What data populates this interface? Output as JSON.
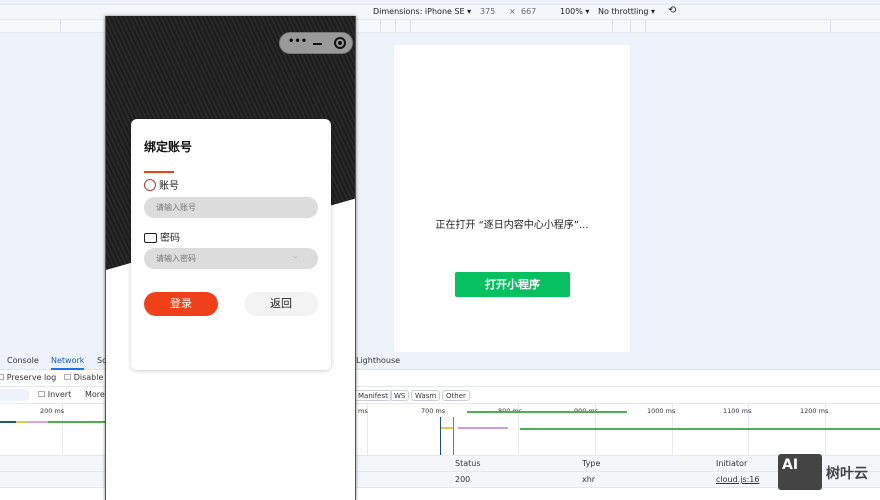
{
  "toolbar": {
    "dimensions_label": "Dimensions: iPhone SE",
    "width": "375",
    "times": "×",
    "height": "667",
    "zoom": "100%",
    "throttling": "No throttling"
  },
  "phone": {
    "card_title": "绑定账号",
    "account_label": "账号",
    "account_placeholder": "请输入账号",
    "password_label": "密码",
    "password_placeholder": "请输入密码",
    "login_button": "登录",
    "back_button": "返回"
  },
  "dialog": {
    "opening_text": "正在打开 “逐日内容中心小程序”...",
    "open_button": "打开小程序"
  },
  "devtools": {
    "tabs": [
      "Console",
      "Network",
      "So",
      "Lighthouse"
    ],
    "preserve_log": "Preserve log",
    "disable_cache": "Disable c",
    "invert": "Invert",
    "more": "More",
    "filter_chips": [
      "Manifest",
      "WS",
      "Wasm",
      "Other"
    ],
    "ticks": [
      "200 ms",
      "ms",
      "700 ms",
      "800 ms",
      "900 ms",
      "1000 ms",
      "1100 ms",
      "1200 ms"
    ],
    "columns": [
      "Status",
      "Type",
      "Initiator"
    ],
    "rows": [
      {
        "status": "200",
        "type": "xhr",
        "initiator": "cloud.js:16"
      }
    ]
  },
  "watermark": {
    "text": "树叶云",
    "logo": "AI"
  },
  "colors": {
    "accent_red": "#f0401a",
    "wechat_green": "#07c160",
    "devtools_blue": "#1a73e8"
  }
}
